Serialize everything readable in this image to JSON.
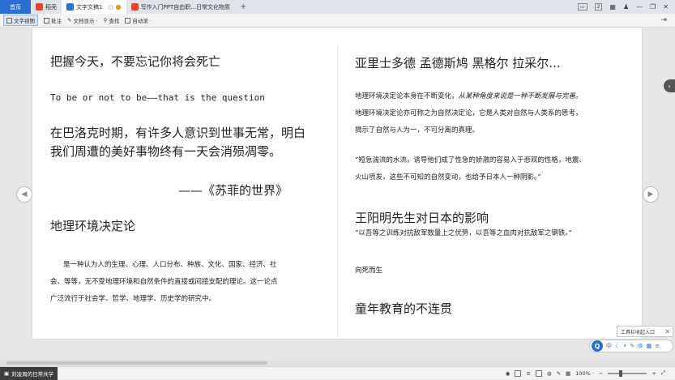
{
  "tabs": {
    "home": "首页",
    "tab1": "稻壳",
    "tab2": "文字文稿1",
    "tab3": "写作入门PPT自由职...日常文化物质"
  },
  "window": {
    "badge": "2"
  },
  "toolbar": {
    "items": [
      "文字视图",
      "批注",
      "文档显示 ·",
      "查找",
      "自动滚 ·"
    ]
  },
  "doc": {
    "left": {
      "heading1": "把握今天，不要忘记你将会死亡",
      "english_quote": "To be or not to be——that is the question",
      "para1_line1": "在巴洛克时期，有许多人意识到世事无常，明白",
      "para1_line2": "我们周遭的美好事物终有一天会消殒凋零。",
      "source": "——《苏菲的世界》",
      "heading2": "地理环境决定论",
      "body_line1": "是一种认为人的生理、心理、人口分布、种族、文化、国家、经济、社",
      "body_line2": "会、等等，无不受地理环境和自然条件的直接或间接支配的理论。这一论点",
      "body_line3": "广泛流行于社会学、哲学、地理学、历史学的研究中。"
    },
    "right": {
      "heading1": "亚里士多德  孟德斯鸠  黑格尔  拉采尔...",
      "line1a": "地理环境决定论本身在不断变化，",
      "line1b": "从某种角度来说是一种不断发展与完善。",
      "line2": "地理环境决定论亦可称之为自然决定论，它是人类对自然与人类系的思考，",
      "line3": "揭示了自然与人为一，不可分离的真理。",
      "quote_line1": "“短急湍流的水流，诱导他们成了性急的娇激的容易入于悲观的性格，地震、",
      "quote_line2": "火山喷发，这些不可知的自然变动，也给予日本人一种阴影。”",
      "heading2": "王阳明先生对日本的影响",
      "quote2": "“以吾等之训练对抗敌军数量上之优势，以吾等之血肉对抗敌军之钢铁。”",
      "phrase": "向死而生",
      "heading3": "童年教育的不连贯"
    }
  },
  "status": {
    "left": "刘凌周的日常共学",
    "zoom": "100% ·"
  },
  "tool_popup": "工具栏收起入口"
}
